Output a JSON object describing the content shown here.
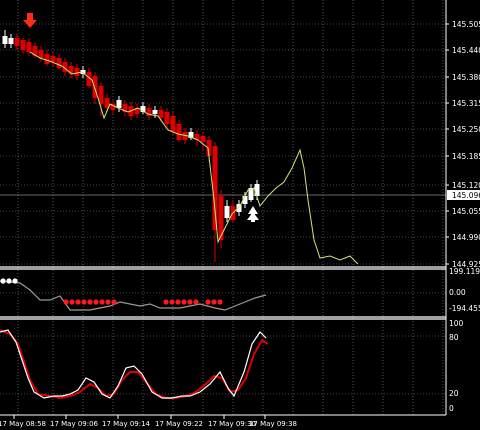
{
  "colors": {
    "background": "#000000",
    "grid": "#8a8a8a",
    "bear_candle": "#e00000",
    "bull_candle": "#ffffff",
    "signal_line": "#c8e87a",
    "arrow_down": "#ff2a1a",
    "arrow_up": "#ffffff",
    "indicator_line": "#9a9a9a",
    "dot_red": "#ff1a1a",
    "dot_white": "#ffffff",
    "stoch_main": "#ffffff",
    "stoch_signal": "#e00000",
    "current_price_line": "#8a8a8a"
  },
  "main_panel": {
    "price_labels": [
      "145.505",
      "145.440",
      "145.380",
      "145.315",
      "145.250",
      "145.185",
      "145.120",
      "145.055",
      "144.990",
      "144.925"
    ],
    "current_price": "145.096",
    "arrows": [
      {
        "direction": "down",
        "icon": "sell-arrow-icon"
      },
      {
        "direction": "up",
        "icon": "buy-arrow-icon"
      }
    ]
  },
  "cci_panel": {
    "labels": [
      "199.1199",
      "0.00",
      "-194.4552"
    ]
  },
  "stoch_panel": {
    "labels": [
      "100",
      "80",
      "20",
      "0"
    ]
  },
  "time_axis": {
    "labels": [
      "17 May 08:58",
      "17 May 09:06",
      "17 May 09:14",
      "17 May 09:22",
      "17 May 09:30",
      "17 May 09:38"
    ]
  }
}
